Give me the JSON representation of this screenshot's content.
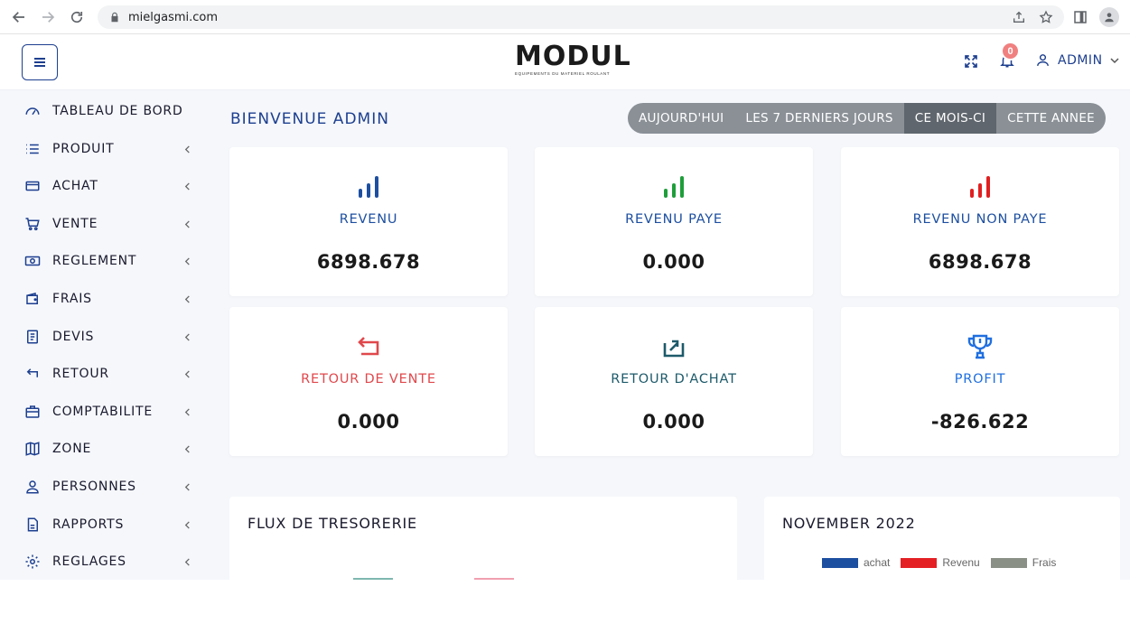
{
  "browser": {
    "url": "mielgasmi.com"
  },
  "header": {
    "logo_text": "MODUL",
    "logo_tagline": "EQUIPEMENTS DU MATERIEL ROULANT",
    "notification_count": "0",
    "user_name": "ADMIN"
  },
  "sidebar": {
    "items": [
      {
        "label": "TABLEAU DE BORD",
        "icon": "speedometer-icon"
      },
      {
        "label": "PRODUIT",
        "icon": "list-icon"
      },
      {
        "label": "ACHAT",
        "icon": "credit-card-icon"
      },
      {
        "label": "VENTE",
        "icon": "cart-icon"
      },
      {
        "label": "REGLEMENT",
        "icon": "cash-icon"
      },
      {
        "label": "FRAIS",
        "icon": "wallet-icon"
      },
      {
        "label": "DEVIS",
        "icon": "document-icon"
      },
      {
        "label": "RETOUR",
        "icon": "return-icon"
      },
      {
        "label": "COMPTABILITE",
        "icon": "briefcase-icon"
      },
      {
        "label": "ZONE",
        "icon": "map-icon"
      },
      {
        "label": "PERSONNES",
        "icon": "user-icon"
      },
      {
        "label": "RAPPORTS",
        "icon": "report-icon"
      },
      {
        "label": "REGLAGES",
        "icon": "gear-icon"
      }
    ]
  },
  "main": {
    "welcome": "BIENVENUE ADMIN",
    "periods": [
      "AUJOURD'HUI",
      "LES 7 DERNIERS JOURS",
      "CE MOIS-CI",
      "CETTE ANNEE"
    ],
    "active_period": "CE MOIS-CI",
    "cards": [
      {
        "label": "REVENU",
        "value": "6898.678",
        "color": "#1d4fa0",
        "icon": "bar-chart-icon"
      },
      {
        "label": "REVENU PAYE",
        "value": "0.000",
        "color": "#1f9e3a",
        "icon": "bar-chart-icon"
      },
      {
        "label": "REVENU NON PAYE",
        "value": "6898.678",
        "color": "#e02020",
        "icon": "bar-chart-icon"
      },
      {
        "label": "RETOUR DE VENTE",
        "value": "0.000",
        "color": "#e0484c",
        "icon": "return-arrow-icon"
      },
      {
        "label": "RETOUR D'ACHAT",
        "value": "0.000",
        "color": "#1d5a6a",
        "icon": "share-arrow-icon"
      },
      {
        "label": "PROFIT",
        "value": "-826.622",
        "color": "#1f6fe0",
        "icon": "trophy-icon"
      }
    ],
    "cashflow_title": "FLUX DE TRESORERIE",
    "month_title": "NOVEMBER 2022",
    "legend": [
      {
        "name": "achat",
        "color": "#1d4fa0"
      },
      {
        "name": "Revenu",
        "color": "#e42025"
      },
      {
        "name": "Frais",
        "color": "#8a9086"
      }
    ]
  }
}
